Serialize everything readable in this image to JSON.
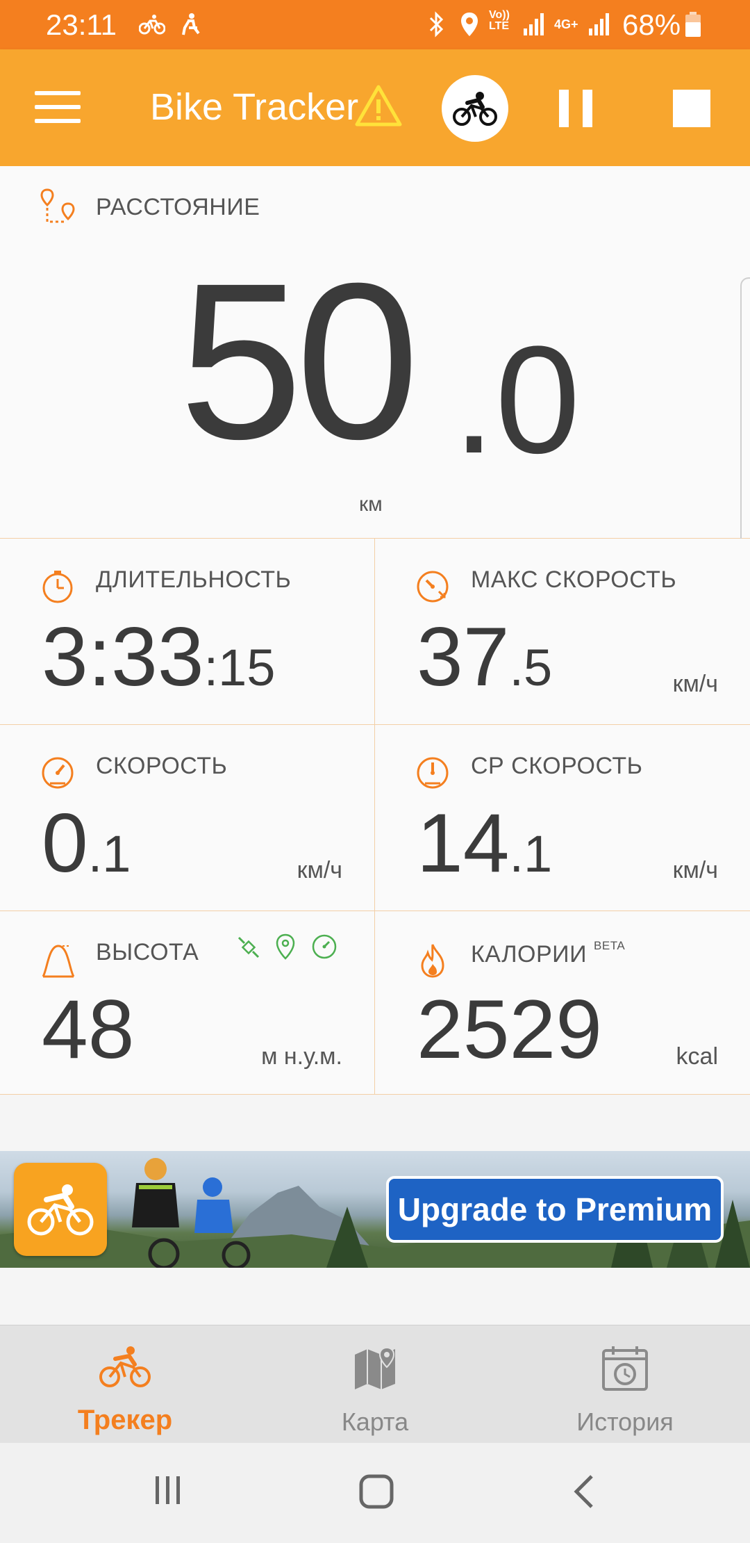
{
  "status_bar": {
    "time": "23:11",
    "battery_percent": "68%",
    "color": "#f47f1f",
    "icons": [
      "bike-notification-icon",
      "walk-notification-icon",
      "bluetooth-icon",
      "location-icon",
      "volte-icon",
      "signal-icon",
      "4g-icon",
      "signal-icon",
      "battery-icon"
    ]
  },
  "app_bar": {
    "title": "Bike Tracker",
    "color": "#f8a62e",
    "icons": [
      "menu-icon",
      "warning-icon",
      "bike-mode-icon",
      "pause-icon",
      "stop-icon"
    ]
  },
  "distance": {
    "label": "РАССТОЯНИЕ",
    "value_int": "50",
    "value_frac": ".0",
    "unit": "км"
  },
  "metrics": [
    {
      "label": "ДЛИТЕЛЬНОСТЬ",
      "value_main": "3:33",
      "value_small": ":15",
      "unit": "",
      "icon": "stopwatch-icon"
    },
    {
      "label": "МАКС СКОРОСТЬ",
      "value_main": "37",
      "value_small": ".5",
      "unit": "км/ч",
      "icon": "max-speed-icon"
    },
    {
      "label": "СКОРОСТЬ",
      "value_main": "0",
      "value_small": ".1",
      "unit": "км/ч",
      "icon": "speedometer-icon"
    },
    {
      "label": "СР СКОРОСТЬ",
      "value_main": "14",
      "value_small": ".1",
      "unit": "км/ч",
      "icon": "avg-speed-icon"
    },
    {
      "label": "ВЫСОТА",
      "value_main": "48",
      "value_small": "",
      "unit": "м н.у.м.",
      "icon": "altitude-icon"
    },
    {
      "label": "КАЛОРИИ",
      "badge": "BETA",
      "value_main": "2529",
      "value_small": "",
      "unit": "kcal",
      "icon": "flame-icon"
    }
  ],
  "altitude_sources": [
    "satellite-icon",
    "gps-pin-icon",
    "barometer-icon"
  ],
  "banner": {
    "cta": "Upgrade to Premium"
  },
  "bottom_nav": {
    "items": [
      {
        "label": "Трекер",
        "active": true,
        "icon": "bike-icon"
      },
      {
        "label": "Карта",
        "active": false,
        "icon": "map-icon"
      },
      {
        "label": "История",
        "active": false,
        "icon": "history-icon"
      }
    ],
    "accent": "#f47f1f"
  }
}
